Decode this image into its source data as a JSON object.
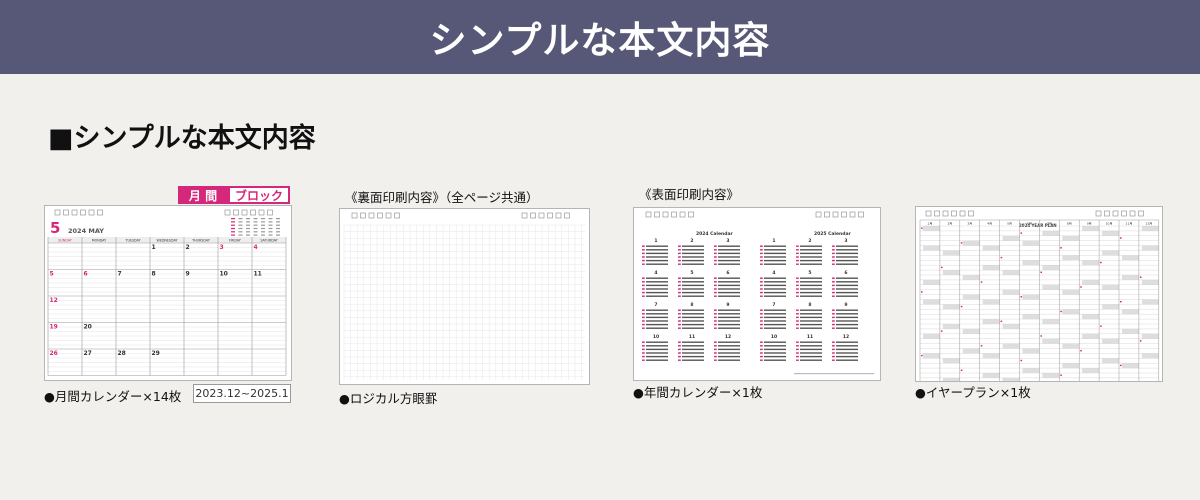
{
  "banner": {
    "title": "シンプルな本文内容"
  },
  "section": {
    "title": "■シンプルな本文内容"
  },
  "monthly": {
    "tag_month": "月 間",
    "tag_block": "ブロック",
    "month_number": "5",
    "year_month": "2024  MAY",
    "weekdays": [
      "SUNDAY",
      "MONDAY",
      "TUESDAY",
      "WEDNESDAY",
      "THURSDAY",
      "FRIDAY",
      "SATURDAY"
    ],
    "day_numbers": [
      "1",
      "2",
      "3",
      "4",
      "5",
      "6",
      "7",
      "8",
      "9",
      "10",
      "11",
      "12",
      "19",
      "20",
      "26",
      "27",
      "28",
      "29"
    ],
    "caption": "●月間カレンダー×14枚",
    "range": "2023.12~2025.1"
  },
  "grid_page": {
    "label": "《裏面印刷内容》（全ページ共通）",
    "caption": "●ロジカル方眼罫"
  },
  "annual": {
    "label": "《表面印刷内容》",
    "title_2024": "2024 Calendar",
    "title_2025": "2025 Calendar",
    "months": [
      "1",
      "2",
      "3",
      "4",
      "5",
      "6",
      "7",
      "8",
      "9",
      "10",
      "11",
      "12"
    ],
    "caption": "●年間カレンダー×1枚"
  },
  "yearplan": {
    "title": "2024  YEAR PLAN",
    "months": [
      "1月",
      "2月",
      "3月",
      "4月",
      "5月",
      "6月",
      "7月",
      "8月",
      "9月",
      "10月",
      "11月",
      "12月"
    ],
    "caption": "●イヤープラン×1枚"
  },
  "colors": {
    "banner": "#575878",
    "accent": "#d6287a",
    "background": "#f2f0ed"
  }
}
